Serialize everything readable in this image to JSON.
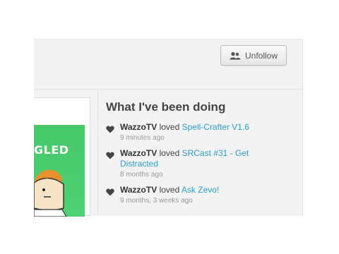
{
  "header": {
    "unfollow_label": "Unfollow",
    "unfollow_icon": "user-group-icon"
  },
  "thumbnail": {
    "caption": "GLED"
  },
  "activity": {
    "title": "What I've been doing",
    "items": [
      {
        "user": "WazzoTV",
        "verb": "loved",
        "target": "Spell-Crafter V1.6",
        "time": "9 minutes ago"
      },
      {
        "user": "WazzoTV",
        "verb": "loved",
        "target": "SRCast #31 - Get Distracted",
        "time": "8 months ago"
      },
      {
        "user": "WazzoTV",
        "verb": "loved",
        "target": "Ask Zevo!",
        "time": "9 months, 3 weeks ago"
      }
    ]
  },
  "colors": {
    "link": "#2a9fd6",
    "thumbnail_bg": "#47c96a",
    "heading": "#444444"
  }
}
